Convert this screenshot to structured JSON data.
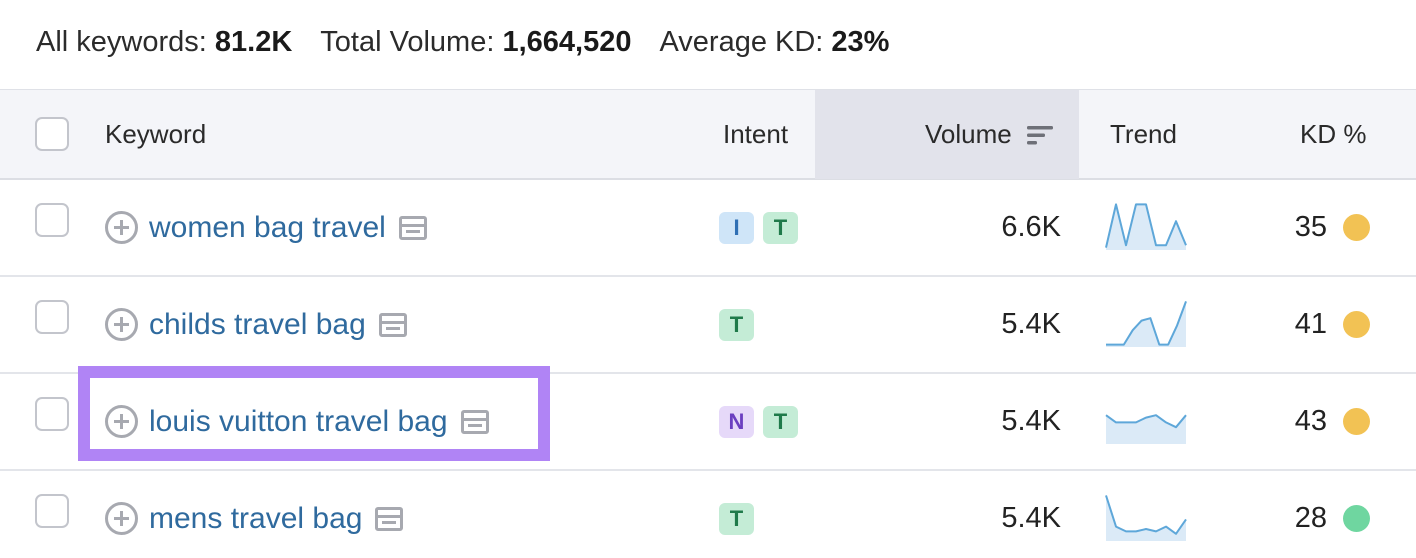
{
  "summary": {
    "all_keywords_label": "All keywords:",
    "all_keywords_value": "81.2K",
    "total_volume_label": "Total Volume:",
    "total_volume_value": "1,664,520",
    "avg_kd_label": "Average KD:",
    "avg_kd_value": "23%"
  },
  "columns": {
    "keyword": "Keyword",
    "intent": "Intent",
    "volume": "Volume",
    "trend": "Trend",
    "kd": "KD %"
  },
  "colors": {
    "link": "#2f6a9e",
    "highlight": "#b084f5",
    "intent_I_bg": "#cfe5f8",
    "intent_I_fg": "#2f6fb4",
    "intent_T_bg": "#c4ecd6",
    "intent_T_fg": "#1f7a4a",
    "intent_N_bg": "#e6d9f9",
    "intent_N_fg": "#6b3fc0",
    "kd_yellow": "#f2c254",
    "kd_green": "#6fd6a0",
    "trend_line": "#5ea7d9",
    "trend_fill": "#dbeaf7"
  },
  "rows": [
    {
      "keyword": "women bag travel",
      "intents": [
        "I",
        "T"
      ],
      "volume": "6.6K",
      "kd": "35",
      "kd_color": "yellow",
      "trend": [
        0.05,
        0.95,
        0.1,
        0.95,
        0.95,
        0.1,
        0.1,
        0.6,
        0.1
      ]
    },
    {
      "keyword": "childs travel bag",
      "intents": [
        "T"
      ],
      "volume": "5.4K",
      "kd": "41",
      "kd_color": "yellow",
      "trend": [
        0.05,
        0.05,
        0.05,
        0.35,
        0.55,
        0.6,
        0.05,
        0.05,
        0.45,
        0.95
      ]
    },
    {
      "keyword": "louis vuitton travel bag",
      "intents": [
        "N",
        "T"
      ],
      "volume": "5.4K",
      "kd": "43",
      "kd_color": "yellow",
      "trend": [
        0.6,
        0.45,
        0.45,
        0.45,
        0.55,
        0.6,
        0.45,
        0.35,
        0.6
      ]
    },
    {
      "keyword": "mens travel bag",
      "intents": [
        "T"
      ],
      "volume": "5.4K",
      "kd": "28",
      "kd_color": "green",
      "trend": [
        0.95,
        0.3,
        0.2,
        0.2,
        0.25,
        0.2,
        0.3,
        0.15,
        0.45
      ]
    }
  ],
  "highlighted_row": 2,
  "icons": {
    "checkbox": "checkbox-icon",
    "add": "plus-circle-icon",
    "serp": "serp-features-icon",
    "sort": "sort-descending-icon"
  }
}
